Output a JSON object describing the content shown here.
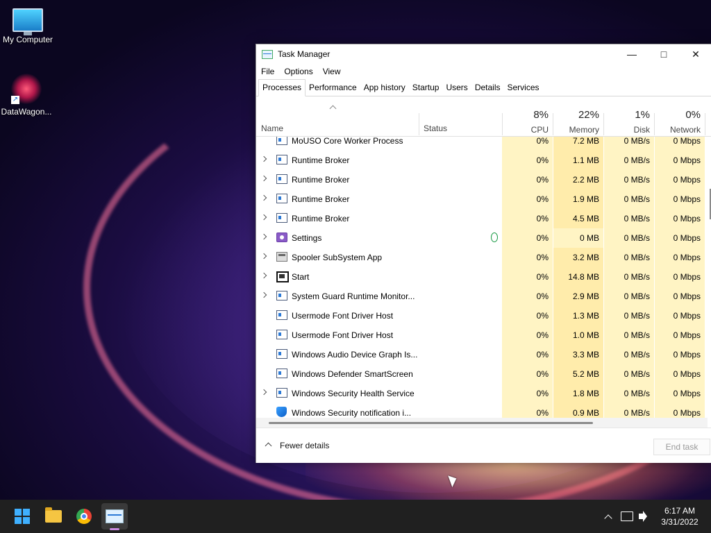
{
  "desktop": {
    "icons": [
      {
        "label": "My Computer",
        "icon": "computer-icon"
      },
      {
        "label": "DataWagon...",
        "icon": "datawagon-icon"
      }
    ]
  },
  "window": {
    "title": "Task Manager",
    "menu": [
      "File",
      "Options",
      "View"
    ],
    "tabs": [
      "Processes",
      "Performance",
      "App history",
      "Startup",
      "Users",
      "Details",
      "Services"
    ],
    "active_tab": "Processes",
    "columns": {
      "name": "Name",
      "status": "Status",
      "cpu": {
        "label": "CPU",
        "percent": "8%"
      },
      "memory": {
        "label": "Memory",
        "percent": "22%"
      },
      "disk": {
        "label": "Disk",
        "percent": "1%"
      },
      "network": {
        "label": "Network",
        "percent": "0%"
      }
    },
    "processes": [
      {
        "name": "MoUSO Core Worker Process",
        "cpu": "0%",
        "memory": "7.2 MB",
        "disk": "0 MB/s",
        "network": "0 Mbps",
        "icon": "app-icon",
        "expandable": false
      },
      {
        "name": "Runtime Broker",
        "cpu": "0%",
        "memory": "1.1 MB",
        "disk": "0 MB/s",
        "network": "0 Mbps",
        "icon": "app-icon",
        "expandable": true
      },
      {
        "name": "Runtime Broker",
        "cpu": "0%",
        "memory": "2.2 MB",
        "disk": "0 MB/s",
        "network": "0 Mbps",
        "icon": "app-icon",
        "expandable": true
      },
      {
        "name": "Runtime Broker",
        "cpu": "0%",
        "memory": "1.9 MB",
        "disk": "0 MB/s",
        "network": "0 Mbps",
        "icon": "app-icon",
        "expandable": true
      },
      {
        "name": "Runtime Broker",
        "cpu": "0%",
        "memory": "4.5 MB",
        "disk": "0 MB/s",
        "network": "0 Mbps",
        "icon": "app-icon",
        "expandable": true
      },
      {
        "name": "Settings",
        "cpu": "0%",
        "memory": "0 MB",
        "disk": "0 MB/s",
        "network": "0 Mbps",
        "icon": "settings-icon",
        "expandable": true,
        "suspended": true
      },
      {
        "name": "Spooler SubSystem App",
        "cpu": "0%",
        "memory": "3.2 MB",
        "disk": "0 MB/s",
        "network": "0 Mbps",
        "icon": "printer-icon",
        "expandable": true
      },
      {
        "name": "Start",
        "cpu": "0%",
        "memory": "14.8 MB",
        "disk": "0 MB/s",
        "network": "0 Mbps",
        "icon": "start-icon",
        "expandable": true
      },
      {
        "name": "System Guard Runtime Monitor...",
        "cpu": "0%",
        "memory": "2.9 MB",
        "disk": "0 MB/s",
        "network": "0 Mbps",
        "icon": "app-icon",
        "expandable": true
      },
      {
        "name": "Usermode Font Driver Host",
        "cpu": "0%",
        "memory": "1.3 MB",
        "disk": "0 MB/s",
        "network": "0 Mbps",
        "icon": "app-icon",
        "expandable": false
      },
      {
        "name": "Usermode Font Driver Host",
        "cpu": "0%",
        "memory": "1.0 MB",
        "disk": "0 MB/s",
        "network": "0 Mbps",
        "icon": "app-icon",
        "expandable": false
      },
      {
        "name": "Windows Audio Device Graph Is...",
        "cpu": "0%",
        "memory": "3.3 MB",
        "disk": "0 MB/s",
        "network": "0 Mbps",
        "icon": "app-icon",
        "expandable": false
      },
      {
        "name": "Windows Defender SmartScreen",
        "cpu": "0%",
        "memory": "5.2 MB",
        "disk": "0 MB/s",
        "network": "0 Mbps",
        "icon": "app-icon",
        "expandable": false
      },
      {
        "name": "Windows Security Health Service",
        "cpu": "0%",
        "memory": "1.8 MB",
        "disk": "0 MB/s",
        "network": "0 Mbps",
        "icon": "app-icon",
        "expandable": true
      },
      {
        "name": "Windows Security notification i...",
        "cpu": "0%",
        "memory": "0.9 MB",
        "disk": "0 MB/s",
        "network": "0 Mbps",
        "icon": "shield-icon",
        "expandable": false
      }
    ],
    "footer": {
      "fewer_details": "Fewer details",
      "end_task": "End task"
    }
  },
  "taskbar": {
    "apps": [
      "start-icon",
      "file-explorer-icon",
      "chrome-icon",
      "task-manager-icon"
    ],
    "clock": {
      "time": "6:17 AM",
      "date": "3/31/2022"
    }
  }
}
